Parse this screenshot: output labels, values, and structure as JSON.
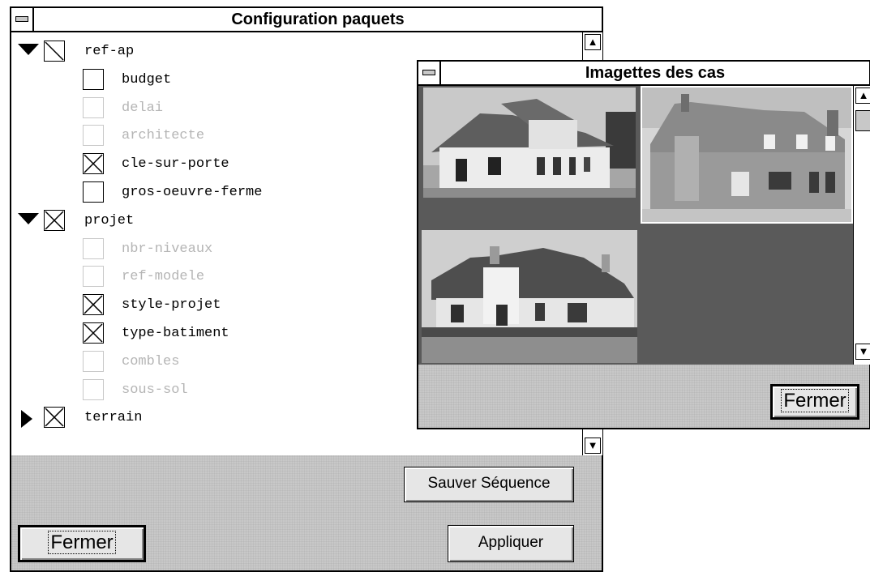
{
  "config_window": {
    "title": "Configuration paquets",
    "tree": [
      {
        "label": "ref-ap",
        "state": "checked",
        "expanded": true,
        "enabled": true,
        "level": 0
      },
      {
        "label": "budget",
        "state": "unchecked",
        "enabled": true,
        "level": 1
      },
      {
        "label": "delai",
        "state": "unchecked",
        "enabled": false,
        "level": 1
      },
      {
        "label": "architecte",
        "state": "unchecked",
        "enabled": false,
        "level": 1
      },
      {
        "label": "cle-sur-porte",
        "state": "checked",
        "enabled": true,
        "level": 1
      },
      {
        "label": "gros-oeuvre-ferme",
        "state": "unchecked",
        "enabled": true,
        "level": 1
      },
      {
        "label": "projet",
        "state": "checked",
        "expanded": true,
        "enabled": true,
        "level": 0
      },
      {
        "label": "nbr-niveaux",
        "state": "unchecked",
        "enabled": false,
        "level": 1
      },
      {
        "label": "ref-modele",
        "state": "unchecked",
        "enabled": false,
        "level": 1
      },
      {
        "label": "style-projet",
        "state": "checked",
        "enabled": true,
        "level": 1
      },
      {
        "label": "type-batiment",
        "state": "checked",
        "enabled": true,
        "level": 1
      },
      {
        "label": "combles",
        "state": "unchecked",
        "enabled": false,
        "level": 1
      },
      {
        "label": "sous-sol",
        "state": "unchecked",
        "enabled": false,
        "level": 1
      },
      {
        "label": "terrain",
        "state": "checked",
        "expanded": false,
        "enabled": true,
        "level": 0
      }
    ],
    "buttons": {
      "save_sequence": "Sauver Séquence",
      "close": "Fermer",
      "apply": "Appliquer"
    }
  },
  "thumbs_window": {
    "title": "Imagettes des cas",
    "thumbnails": [
      {
        "name": "house-thumbnail-1"
      },
      {
        "name": "house-thumbnail-2",
        "selected": true
      },
      {
        "name": "house-thumbnail-3"
      }
    ],
    "buttons": {
      "close": "Fermer"
    }
  },
  "icons": {
    "scroll_up": "up-arrow-icon",
    "scroll_down": "down-arrow-icon",
    "system_menu": "system-menu-icon"
  }
}
